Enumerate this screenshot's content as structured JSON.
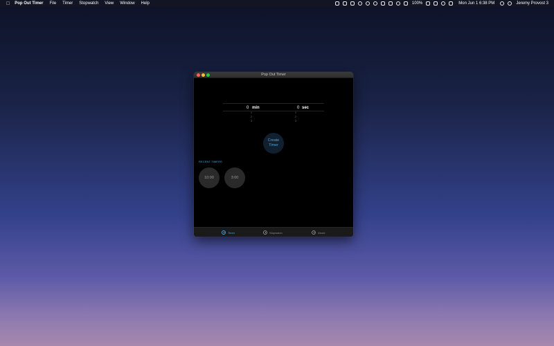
{
  "menubar": {
    "apple_icon": "apple-icon",
    "app_name": "Pop Out Timer",
    "items": [
      "File",
      "Timer",
      "Stopwatch",
      "View",
      "Window",
      "Help"
    ],
    "battery": "100%",
    "datetime": "Mon Jun 1  6:38 PM",
    "user": "Jeremy Provost 3"
  },
  "window": {
    "title": "Pop Out Timer",
    "minutes_value": "0",
    "minutes_unit": "min",
    "seconds_value": "0",
    "seconds_unit": "sec",
    "minutes_next": [
      "1",
      "2",
      "3"
    ],
    "seconds_next": [
      "1",
      "2",
      "3"
    ],
    "create_button": "Create Timer",
    "recent_label": "RECENT TIMERS",
    "recent_timers": [
      "10:00",
      "3:00"
    ]
  },
  "tabs": [
    {
      "label": "Timer",
      "icon": "timer-icon",
      "active": true
    },
    {
      "label": "Stopwatch",
      "icon": "stopwatch-icon",
      "active": false
    },
    {
      "label": "About",
      "icon": "info-icon",
      "active": false
    }
  ],
  "colors": {
    "accent": "#4ba3e3",
    "window_bg": "#000000",
    "recent_bg": "#2a2a2a",
    "close": "#fe5f57",
    "minimize": "#febc2e",
    "maximize": "#28c840"
  }
}
